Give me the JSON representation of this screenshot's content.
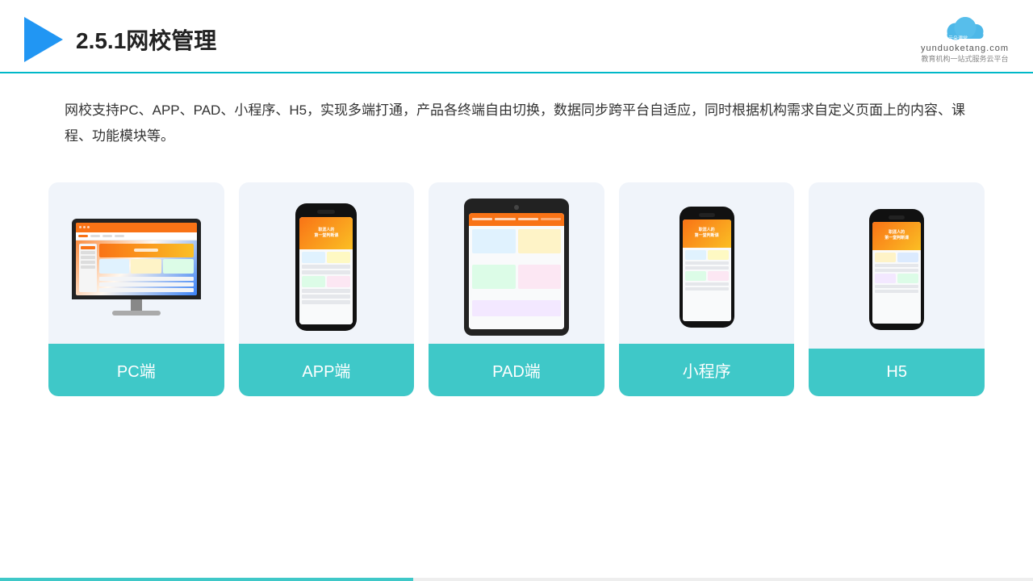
{
  "header": {
    "title": "2.5.1网校管理",
    "brand_name": "云朵课堂",
    "brand_url": "yunduoketang.com",
    "brand_tagline": "教育机构一站式服务云平台"
  },
  "description": {
    "text": "网校支持PC、APP、PAD、小程序、H5，实现多端打通，产品各终端自由切换，数据同步跨平台自适应，同时根据机构需求自定义页面上的内容、课程、功能模块等。"
  },
  "cards": [
    {
      "id": "pc",
      "label": "PC端"
    },
    {
      "id": "app",
      "label": "APP端"
    },
    {
      "id": "pad",
      "label": "PAD端"
    },
    {
      "id": "miniprogram",
      "label": "小程序"
    },
    {
      "id": "h5",
      "label": "H5"
    }
  ],
  "colors": {
    "accent": "#3fc8c8",
    "header_line": "#00b8c8",
    "triangle": "#2196f3",
    "title": "#222222",
    "text": "#333333"
  }
}
